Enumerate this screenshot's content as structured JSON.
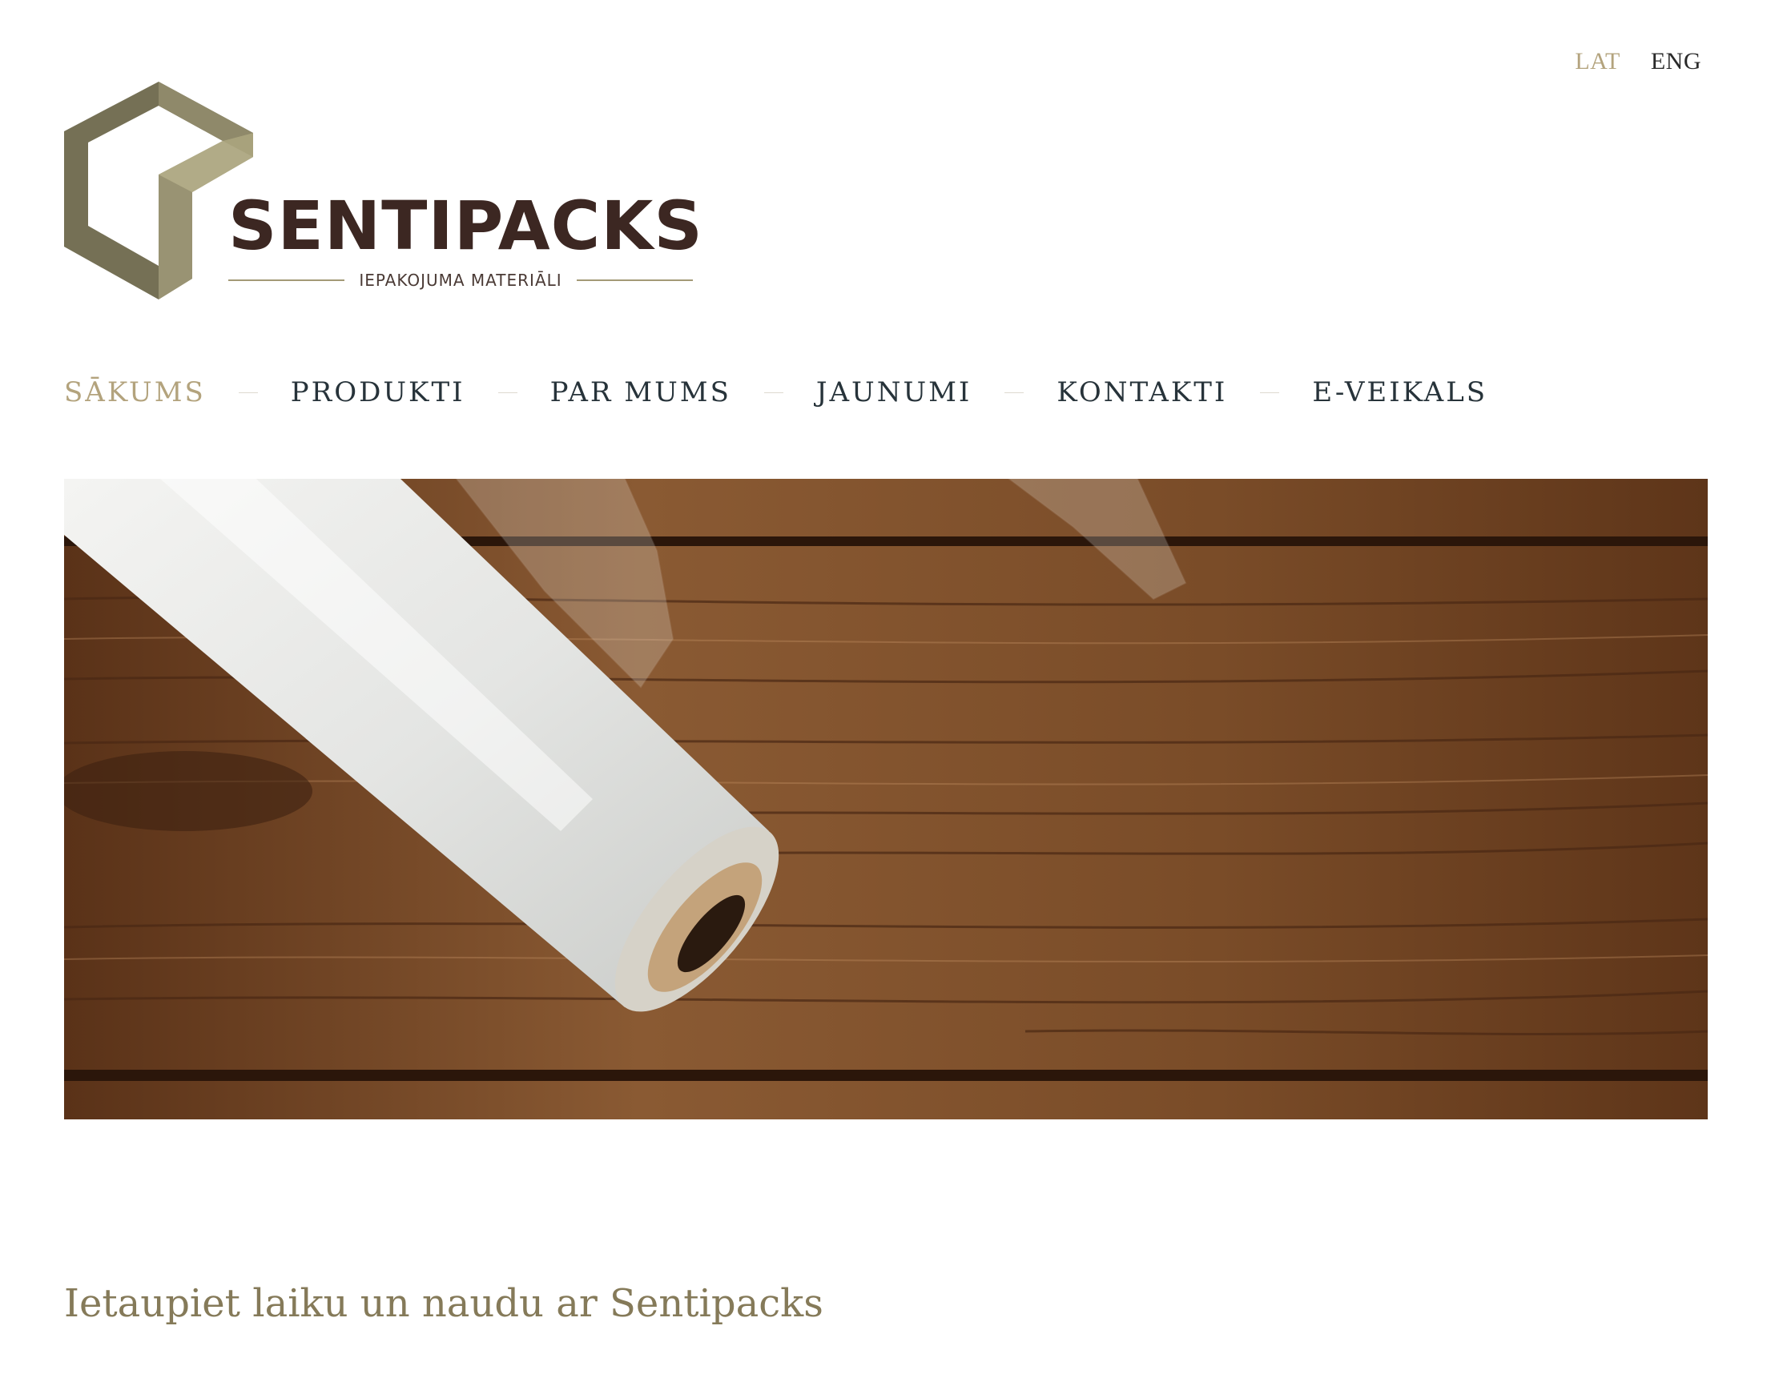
{
  "language_switcher": {
    "active": "LAT",
    "other": "ENG"
  },
  "logo": {
    "brand": "SENTIPACKS",
    "tagline": "IEPAKOJUMA MATERIĀLI",
    "colors": {
      "dark": "#757055",
      "light": "#a8a27c",
      "text": "#3c2722"
    }
  },
  "nav": {
    "items": [
      {
        "label": "SĀKUMS",
        "active": true
      },
      {
        "label": "PRODUKTI",
        "active": false
      },
      {
        "label": "PAR MUMS",
        "active": false
      },
      {
        "label": "JAUNUMI",
        "active": false
      },
      {
        "label": "KONTAKTI",
        "active": false
      },
      {
        "label": "E-VEIKALS",
        "active": false
      }
    ],
    "active_color": "#b3a37d",
    "text_color": "#27333a"
  },
  "hero": {
    "image": "stretch-film-roll-on-wooden-table"
  },
  "main": {
    "heading": "Ietaupiet laiku un naudu ar Sentipacks"
  }
}
